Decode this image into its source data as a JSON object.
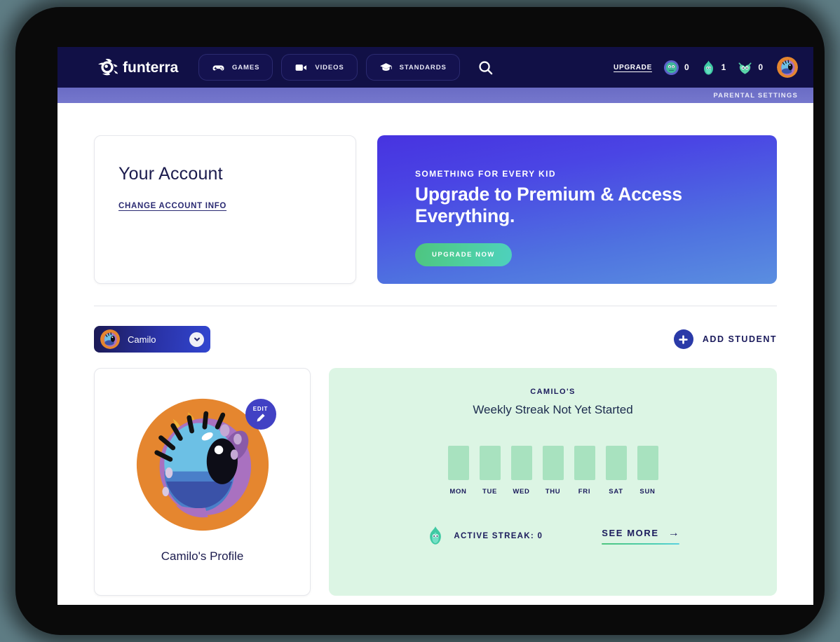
{
  "header": {
    "logo_text": "funterra",
    "logo_icon": "funterra-creature-logo",
    "nav": [
      {
        "label": "GAMES",
        "icon": "gamepad-icon"
      },
      {
        "label": "VIDEOS",
        "icon": "video-camera-icon"
      },
      {
        "label": "STANDARDS",
        "icon": "graduation-cap-icon"
      }
    ],
    "search_icon": "search-icon",
    "upgrade_label": "UPGRADE",
    "counters": [
      {
        "icon": "coin-monster-icon",
        "value": "0"
      },
      {
        "icon": "flame-streak-icon",
        "value": "1"
      },
      {
        "icon": "owl-monster-icon",
        "value": "0"
      }
    ],
    "avatar_icon": "user-avatar-monster"
  },
  "parental": {
    "label": "PARENTAL SETTINGS"
  },
  "account": {
    "title": "Your Account",
    "change_link": "CHANGE ACCOUNT INFO"
  },
  "promo": {
    "eyebrow": "SOMETHING FOR EVERY KID",
    "title": "Upgrade to Premium & Access Everything.",
    "button": "UPGRADE NOW",
    "gradient_from": "#4733e0",
    "gradient_to": "#5a8ee0",
    "button_gradient_from": "#4ec57f",
    "button_gradient_to": "#4ed0be"
  },
  "student_selector": {
    "name": "Camilo",
    "avatar_icon": "user-avatar-monster",
    "chevron_icon": "chevron-down-icon"
  },
  "add_student": {
    "label": "ADD STUDENT",
    "icon": "plus-icon"
  },
  "profile": {
    "avatar_icon": "monster-avatar-large",
    "edit_label": "EDIT",
    "edit_icon": "pencil-icon",
    "name": "Camilo's Profile"
  },
  "streak": {
    "owner": "CAMILO'S",
    "headline": "Weekly Streak Not Yet Started",
    "days": [
      {
        "label": "MON"
      },
      {
        "label": "TUE"
      },
      {
        "label": "WED"
      },
      {
        "label": "THU"
      },
      {
        "label": "FRI"
      },
      {
        "label": "SAT"
      },
      {
        "label": "SUN"
      }
    ],
    "active_streak_label": "ACTIVE STREAK: 0",
    "flame_icon": "flame-streak-icon",
    "see_more_label": "SEE MORE",
    "see_more_arrow": "→",
    "card_bg": "#dcf5e4",
    "bar_color": "#a8e2bf"
  }
}
